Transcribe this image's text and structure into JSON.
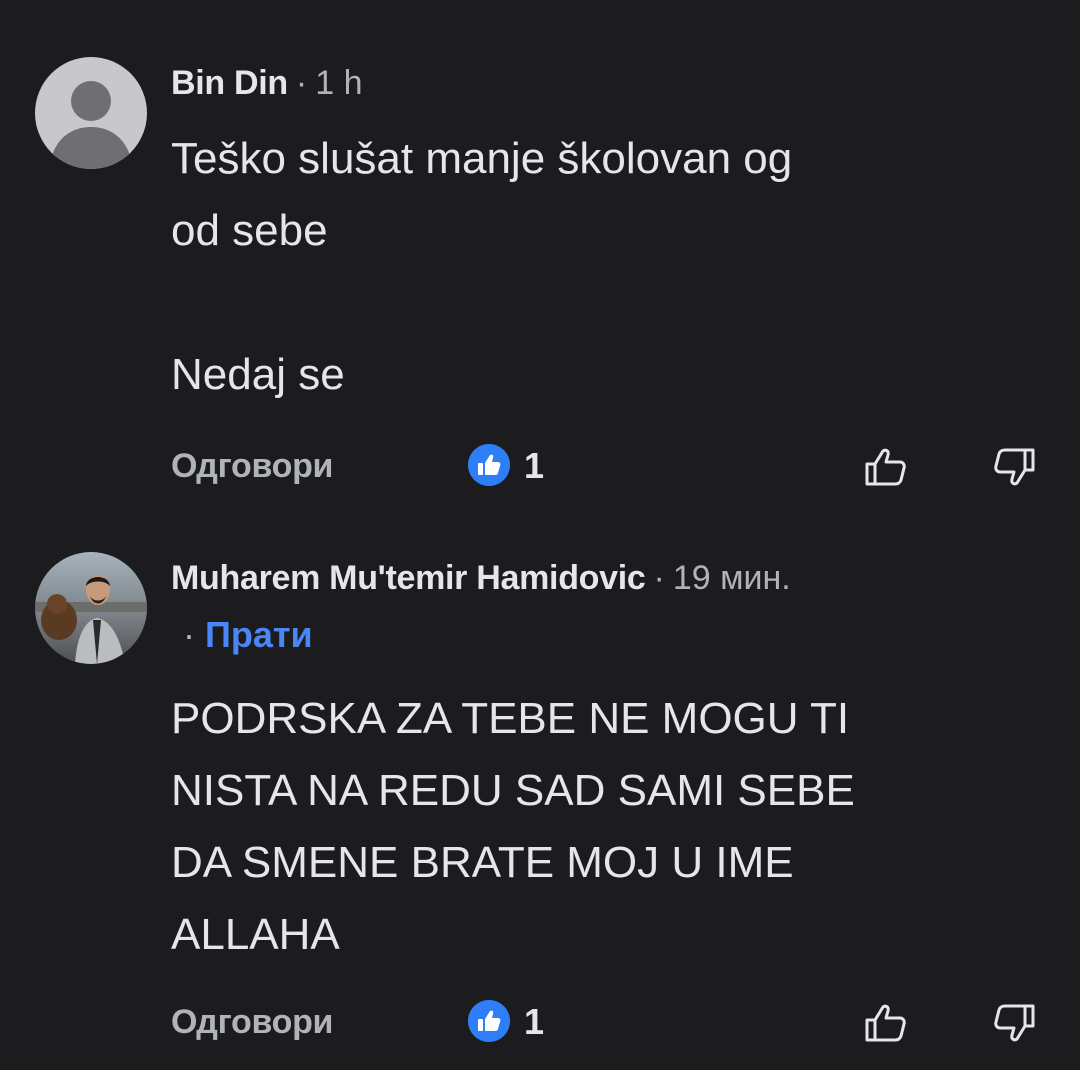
{
  "comments": [
    {
      "author": "Bin Din",
      "time": "1 h",
      "separator": "·",
      "avatar": "default-avatar-icon",
      "body_lines": [
        "Teško slušat manje školovan og",
        "od sebe",
        "",
        "Nedaj se"
      ],
      "reply_label": "Одговори",
      "reaction_icon": "like-reaction-icon",
      "reaction_count": "1"
    },
    {
      "author": "Muharem Mu'temir Hamidovic",
      "time": "19 мин.",
      "separator": "·",
      "follow_label": "Прати",
      "avatar": "profile-photo-avatar",
      "body_lines": [
        "PODRSKA ZA TEBE NE MOGU TI",
        "NISTA NA REDU SAD SAMI SEBE",
        "DA SMENE BRATE MOJ U IME",
        "ALLAHA"
      ],
      "reply_label": "Одговори",
      "reaction_icon": "like-reaction-icon",
      "reaction_count": "1"
    }
  ],
  "colors": {
    "background": "#1c1c1e",
    "text": "#e4e6eb",
    "muted": "#b0b3b8",
    "accent": "#4a86f7",
    "reaction": "#2d7ef7"
  }
}
